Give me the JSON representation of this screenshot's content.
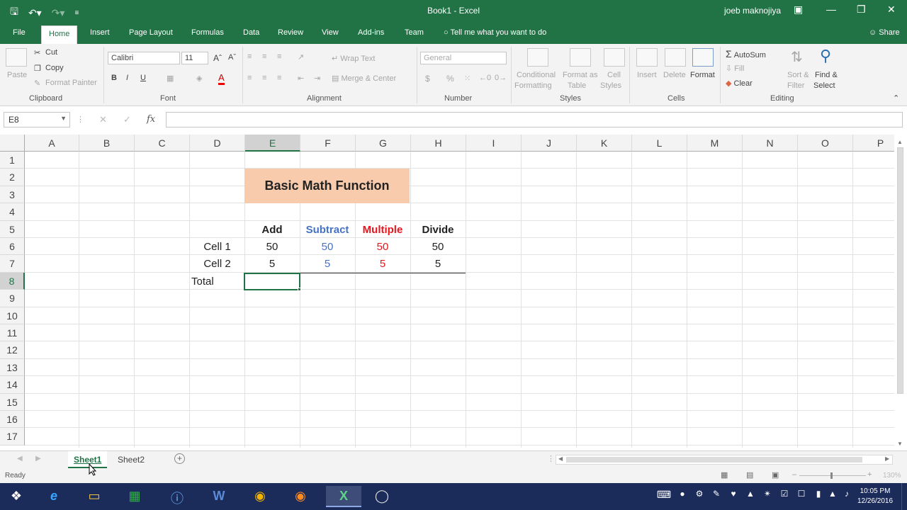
{
  "window": {
    "title": "Book1 - Excel",
    "user": "joeb maknojiya"
  },
  "menu": [
    "File",
    "Home",
    "Insert",
    "Page Layout",
    "Formulas",
    "Data",
    "Review",
    "View",
    "Add-ins",
    "Team"
  ],
  "tellme": "Tell me what you want to do",
  "share": "Share",
  "ribbon": {
    "clipboard": {
      "paste": "Paste",
      "cut": "Cut",
      "copy": "Copy",
      "format_painter": "Format Painter",
      "group": "Clipboard"
    },
    "font": {
      "name": "Calibri",
      "size": "11",
      "bold": "B",
      "italic": "I",
      "underline": "U",
      "group": "Font"
    },
    "alignment": {
      "wrap": "Wrap Text",
      "merge": "Merge & Center",
      "group": "Alignment"
    },
    "number": {
      "format": "General",
      "currency": "$",
      "percent": "%",
      "group": "Number"
    },
    "styles": {
      "cond1": "Conditional",
      "cond2": "Formatting",
      "fmt1": "Format as",
      "fmt2": "Table",
      "cell1": "Cell",
      "cell2": "Styles",
      "group": "Styles"
    },
    "cells": {
      "insert": "Insert",
      "delete": "Delete",
      "format": "Format",
      "group": "Cells"
    },
    "editing": {
      "autosum": "AutoSum",
      "fill": "Fill",
      "clear": "Clear",
      "sort1": "Sort &",
      "sort2": "Filter",
      "find1": "Find &",
      "find2": "Select",
      "group": "Editing"
    }
  },
  "formula_bar": {
    "name_box": "E8",
    "fx": "fx",
    "cancel": "✕",
    "enter": "✓"
  },
  "columns": [
    "A",
    "B",
    "C",
    "D",
    "E",
    "F",
    "G",
    "H",
    "I",
    "J",
    "K",
    "L",
    "M",
    "N",
    "O",
    "P"
  ],
  "rows": [
    "1",
    "2",
    "3",
    "4",
    "5",
    "6",
    "7",
    "8",
    "9",
    "10",
    "11",
    "12",
    "13",
    "14",
    "15",
    "16",
    "17"
  ],
  "selected_cell": "E8",
  "sheet": {
    "title": "Basic Math Function",
    "headers": [
      "Add",
      "Subtract",
      "Multiple",
      "Divide"
    ],
    "row_labels": [
      "Cell 1",
      "Cell 2",
      "Total"
    ],
    "cell1": [
      "50",
      "50",
      "50",
      "50"
    ],
    "cell2": [
      "5",
      "5",
      "5",
      "5"
    ]
  },
  "colors": {
    "accent": "#217346",
    "title_fill": "#f8cbad",
    "subtract": "#4472c4",
    "multiple": "#e7151c"
  },
  "tabs": [
    "Sheet1",
    "Sheet2"
  ],
  "active_tab": "Sheet1",
  "status": "Ready",
  "zoom": "130%",
  "clock": {
    "time": "10:05 PM",
    "date": "12/26/2016"
  }
}
